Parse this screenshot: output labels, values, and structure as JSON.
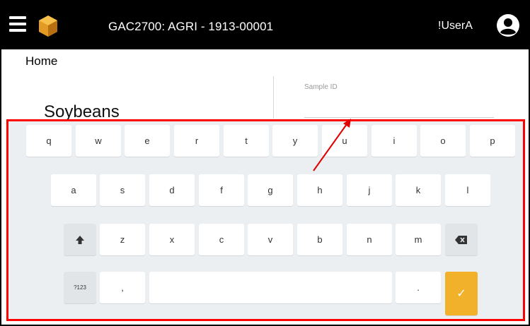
{
  "header": {
    "title": "GAC2700: AGRI - 1913-00001",
    "user": "!UserA"
  },
  "breadcrumb": "Home",
  "product_name": "Soybeans",
  "sample_field": {
    "label": "Sample ID",
    "value": ""
  },
  "keyboard": {
    "row1": [
      "q",
      "w",
      "e",
      "r",
      "t",
      "y",
      "u",
      "i",
      "o",
      "p"
    ],
    "row2": [
      "a",
      "s",
      "d",
      "f",
      "g",
      "h",
      "j",
      "k",
      "l"
    ],
    "row3": [
      "z",
      "x",
      "c",
      "v",
      "b",
      "n",
      "m"
    ],
    "numbers_key": "?123",
    "comma_key": ",",
    "period_key": ".",
    "done_key": "✓"
  },
  "colors": {
    "topbar": "#000000",
    "accent": "#f1b12b",
    "highlight": "#ff0000",
    "keyboard_bg": "#eceff2"
  }
}
